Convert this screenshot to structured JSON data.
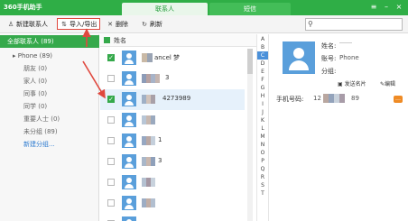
{
  "app": {
    "title": "360手机助手"
  },
  "tabs": [
    {
      "label": "联系人"
    },
    {
      "label": "短信"
    }
  ],
  "toolbar": {
    "new_contact": "新建联系人",
    "import_export": "导入/导出",
    "delete": "删除",
    "refresh": "刷新"
  },
  "search": {
    "placeholder": ""
  },
  "sidebar": {
    "all_contacts": "全部联系人 (89)",
    "phone": "Phone (89)",
    "groups": [
      {
        "label": "朋友 (0)"
      },
      {
        "label": "家人 (0)"
      },
      {
        "label": "同事 (0)"
      },
      {
        "label": "同学 (0)"
      },
      {
        "label": "重要人士 (0)"
      },
      {
        "label": "未分组 (89)"
      }
    ],
    "new_group": "新建分组..."
  },
  "list": {
    "header": "姓名",
    "rows": [
      {
        "text": "ancel 梦",
        "checked": true,
        "selected": false
      },
      {
        "text": "3",
        "checked": false,
        "selected": false
      },
      {
        "text": "4273989",
        "checked": true,
        "selected": true
      },
      {
        "text": "",
        "checked": false,
        "selected": false
      },
      {
        "text": "1",
        "checked": false,
        "selected": false
      },
      {
        "text": "3",
        "checked": false,
        "selected": false
      },
      {
        "text": "",
        "checked": false,
        "selected": false
      },
      {
        "text": "",
        "checked": false,
        "selected": false
      },
      {
        "text": "",
        "checked": false,
        "selected": false
      }
    ]
  },
  "alphabet": {
    "active": "C",
    "letters": [
      "A",
      "B",
      "C",
      "D",
      "E",
      "F",
      "G",
      "H",
      "I",
      "J",
      "K",
      "L",
      "M",
      "N",
      "O",
      "P",
      "Q",
      "R",
      "S",
      "T"
    ]
  },
  "detail": {
    "name_label": "姓名:",
    "account_label": "账号:",
    "account_value": "Phone",
    "group_label": "分组:",
    "send_card": "发送名片",
    "edit": "编辑",
    "phone_label": "手机号码:",
    "phone_prefix": "12",
    "phone_suffix": "89"
  },
  "colors": {
    "brand_green": "#2fae46",
    "accent_blue": "#4a90d9",
    "avatar_blue": "#5a9fdb",
    "annotation_red": "#e0483e"
  }
}
